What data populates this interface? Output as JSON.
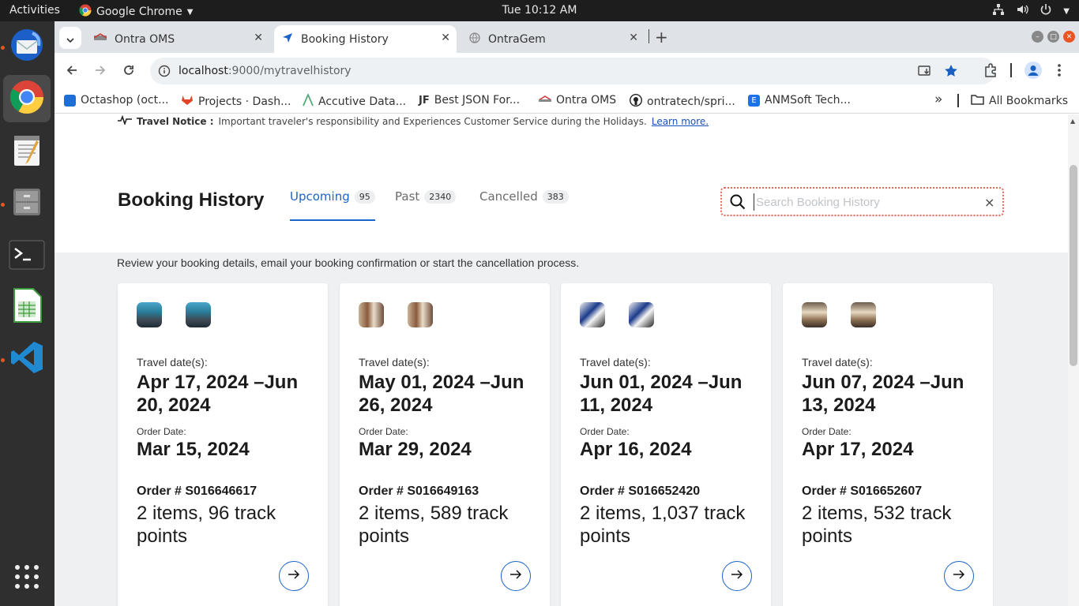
{
  "system": {
    "activities": "Activities",
    "app_name": "Google Chrome",
    "clock": "Tue 10:12 AM"
  },
  "dock": {
    "apps": [
      "thunderbird-icon",
      "chrome-icon",
      "text-editor-icon",
      "file-cabinet-icon",
      "terminal-icon",
      "spreadsheet-icon",
      "vscode-icon",
      "app-grid-icon"
    ]
  },
  "tabs": [
    {
      "title": "Ontra OMS"
    },
    {
      "title": "Booking History"
    },
    {
      "title": "OntraGem"
    }
  ],
  "address": {
    "host": "localhost",
    "path": ":9000/mytravelhistory"
  },
  "bookmarks": {
    "items": [
      "Octashop (oct...",
      "Projects · Dash...",
      "Accutive Data...",
      "Best JSON For...",
      "Ontra OMS",
      "ontratech/spri...",
      "ANMSoft Tech..."
    ],
    "overflow": "»",
    "all": "All Bookmarks"
  },
  "notice": {
    "label": "Travel Notice :",
    "text": "Important traveler's responsibility and Experiences Customer Service during the Holidays.",
    "link": "Learn more."
  },
  "history": {
    "title": "Booking History",
    "tabs": [
      {
        "label": "Upcoming",
        "count": "95"
      },
      {
        "label": "Past",
        "count": "2340"
      },
      {
        "label": "Cancelled",
        "count": "383"
      }
    ],
    "search_placeholder": "Search Booking History",
    "clear": "×",
    "subtitle": "Review your booking details, email your booking confirmation or start the cancellation process."
  },
  "cards": [
    {
      "travel_label": "Travel date(s):",
      "travel_dates": "Apr 17, 2024 –Jun 20, 2024",
      "order_label": "Order Date:",
      "order_date": "Mar 15, 2024",
      "order_number": "Order # S016646617",
      "items": "2 items, 96 track points"
    },
    {
      "travel_label": "Travel date(s):",
      "travel_dates": "May 01, 2024 –Jun 26, 2024",
      "order_label": "Order Date:",
      "order_date": "Mar 29, 2024",
      "order_number": "Order # S016649163",
      "items": "2 items, 589 track points"
    },
    {
      "travel_label": "Travel date(s):",
      "travel_dates": "Jun 01, 2024 –Jun 11, 2024",
      "order_label": "Order Date:",
      "order_date": "Apr 16, 2024",
      "order_number": "Order # S016652420",
      "items": "2 items, 1,037 track points"
    },
    {
      "travel_label": "Travel date(s):",
      "travel_dates": "Jun 07, 2024 –Jun 13, 2024",
      "order_label": "Order Date:",
      "order_date": "Apr 17, 2024",
      "order_number": "Order # S016652607",
      "items": "2 items, 532 track points"
    }
  ],
  "colors": {
    "accent": "#1b64c8",
    "ubuntu_orange": "#e95420",
    "search_border": "#e36a5a"
  }
}
